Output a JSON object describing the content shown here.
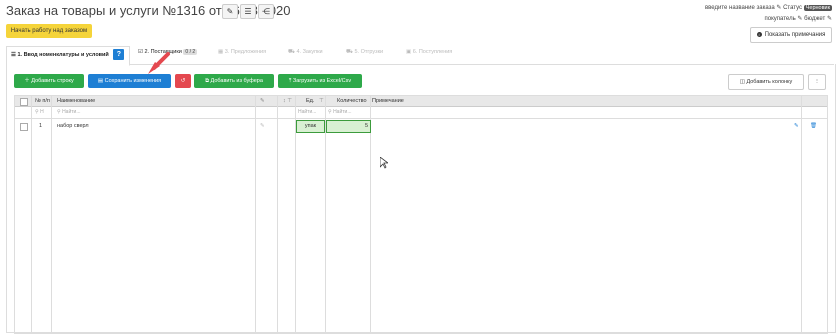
{
  "header": {
    "title": "Заказ на товары и услуги №1316 от 06.08.2020",
    "order_name_placeholder": "введите название заказа",
    "status_label": "Статус",
    "status_value": "Черновик",
    "buyer_label": "покупатель",
    "budget_label": "бюджет"
  },
  "actions": {
    "start_work": "Начать работу над заказом",
    "show_notes": "Показать примечания"
  },
  "tabs": [
    {
      "label": "1. Ввод номенклатуры и условий",
      "help": "?"
    },
    {
      "label": "2. Поставщики",
      "counter": "0 / 2"
    },
    {
      "label": "3. Предложения"
    },
    {
      "label": "4. Закупки"
    },
    {
      "label": "5. Отгрузки"
    },
    {
      "label": "6. Поступления"
    }
  ],
  "toolbar": {
    "add_row": "Добавить строку",
    "save_changes": "Сохранить изменения",
    "add_from_buffer": "Добавить из буфера",
    "load_excel": "Загрузить из Excel/Csv",
    "add_column": "Добавить колонку",
    "more": "⋮"
  },
  "table": {
    "headers": [
      "№ п/п",
      "Наименование",
      "Ед.",
      "Количество",
      "Примечание"
    ],
    "filter_placeholder": "Найти...",
    "filter_short": "Н",
    "rows": [
      {
        "num": "1",
        "name": "набор сверл",
        "unit": "упак",
        "qty": "5",
        "note": ""
      }
    ]
  },
  "colors": {
    "green": "#2ea94a",
    "blue": "#1e7fd4",
    "red": "#e4484f",
    "yellow": "#f5d43a"
  }
}
